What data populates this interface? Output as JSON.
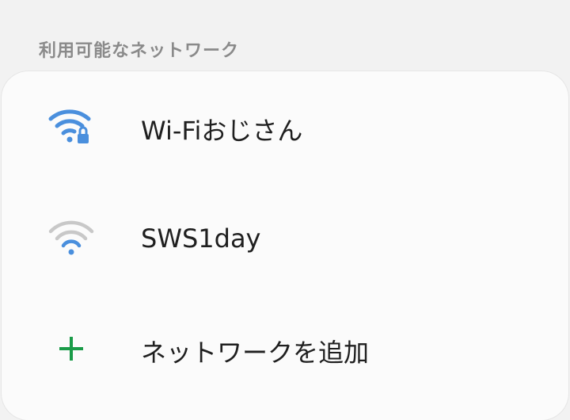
{
  "section": {
    "title": "利用可能なネットワーク"
  },
  "networks": [
    {
      "name": "Wi-Fiおじさん",
      "icon": "wifi-locked-icon",
      "secured": true,
      "color": "#4a8fdd"
    },
    {
      "name": "SWS1day",
      "icon": "wifi-open-icon",
      "secured": false,
      "color": "#4a8fdd"
    }
  ],
  "add_network": {
    "label": "ネットワークを追加",
    "icon": "plus-icon",
    "color": "#1a9b48"
  }
}
